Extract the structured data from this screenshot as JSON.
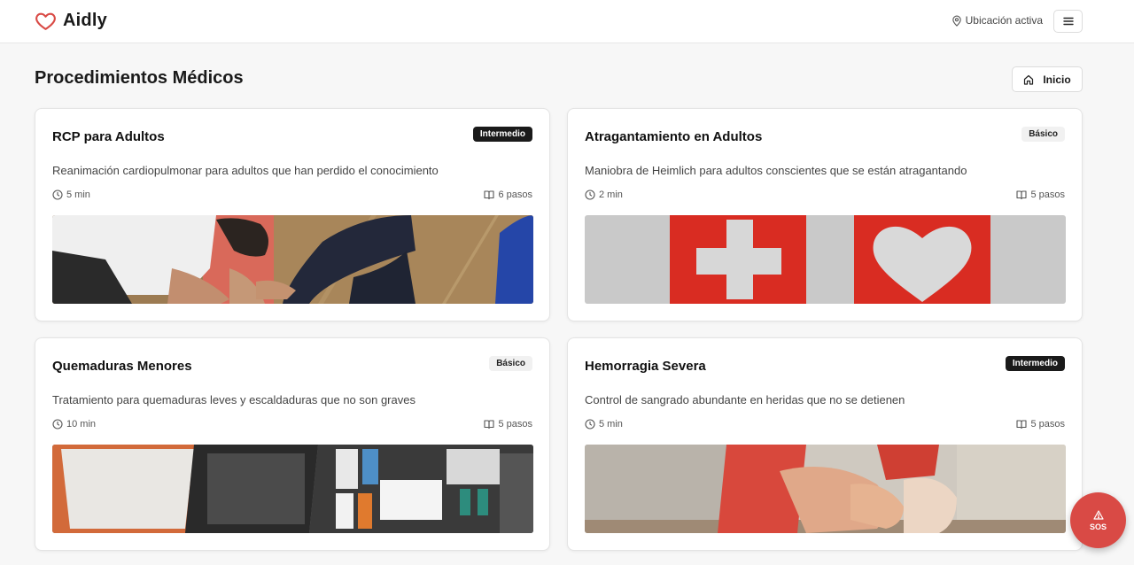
{
  "header": {
    "app_name": "Aidly",
    "location_label": "Ubicación activa",
    "logo_icon": "heart-icon",
    "menu_icon": "menu-icon"
  },
  "page": {
    "title": "Procedimientos Médicos",
    "home_label": "Inicio"
  },
  "procedures": [
    {
      "title": "RCP para Adultos",
      "level": "Intermedio",
      "description": "Reanimación cardiopulmonar para adultos que han perdido el conocimiento",
      "duration": "5 min",
      "steps": "6 pasos",
      "image": "cpr-training-photo"
    },
    {
      "title": "Atragantamiento en Adultos",
      "level": "Básico",
      "description": "Maniobra de Heimlich para adultos conscientes que se están atragantando",
      "duration": "2 min",
      "steps": "5 pasos",
      "image": "first-aid-cross-heart-photo"
    },
    {
      "title": "Quemaduras Menores",
      "level": "Básico",
      "description": "Tratamiento para quemaduras leves y escaldaduras que no son graves",
      "duration": "10 min",
      "steps": "5 pasos",
      "image": "first-aid-kit-photo"
    },
    {
      "title": "Hemorragia Severa",
      "level": "Intermedio",
      "description": "Control de sangrado abundante en heridas que no se detienen",
      "duration": "5 min",
      "steps": "5 pasos",
      "image": "injured-athlete-photo"
    }
  ],
  "sos": {
    "label": "SOS",
    "icon": "alert-triangle-icon"
  },
  "colors": {
    "accent": "#d94a45",
    "badge_dark": "#1a1a1a",
    "badge_light": "#f1f1f1"
  }
}
